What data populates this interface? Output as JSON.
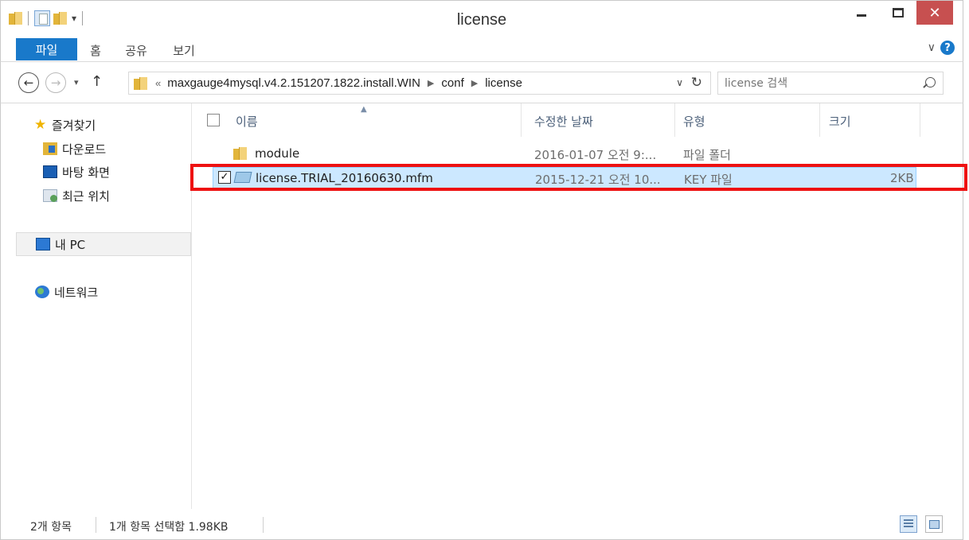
{
  "window": {
    "title": "license"
  },
  "ribbon": {
    "tabs": [
      {
        "label": "파일"
      },
      {
        "label": "홈"
      },
      {
        "label": "공유"
      },
      {
        "label": "보기"
      }
    ]
  },
  "address": {
    "overflow": "«",
    "crumbs": [
      "maxgauge4mysql.v4.2.151207.1822.install.WIN",
      "conf",
      "license"
    ],
    "search_placeholder": "license 검색"
  },
  "nav": {
    "favorites_label": "즐겨찾기",
    "items": [
      {
        "label": "다운로드",
        "icon": "downloads-folder-icon"
      },
      {
        "label": "바탕 화면",
        "icon": "desktop-icon"
      },
      {
        "label": "최근 위치",
        "icon": "recent-places-icon"
      }
    ],
    "this_pc": "내 PC",
    "network": "네트워크"
  },
  "columns": {
    "name": "이름",
    "modified": "수정한 날짜",
    "type": "유형",
    "size": "크기"
  },
  "files": [
    {
      "name": "module",
      "modified": "2016-01-07 오전 9:...",
      "type": "파일 폴더",
      "size": "",
      "icon": "folder-icon",
      "selected": false
    },
    {
      "name": "license.TRIAL_20160630.mfm",
      "modified": "2015-12-21 오전 10...",
      "type": "KEY 파일",
      "size": "2KB",
      "icon": "key-file-icon",
      "selected": true
    }
  ],
  "status": {
    "count": "2개 항목",
    "selection": "1개 항목 선택함 1.98KB"
  },
  "colors": {
    "accent": "#1979ca",
    "selection_bg": "#cce8ff",
    "annotation_red": "#ee1111"
  }
}
